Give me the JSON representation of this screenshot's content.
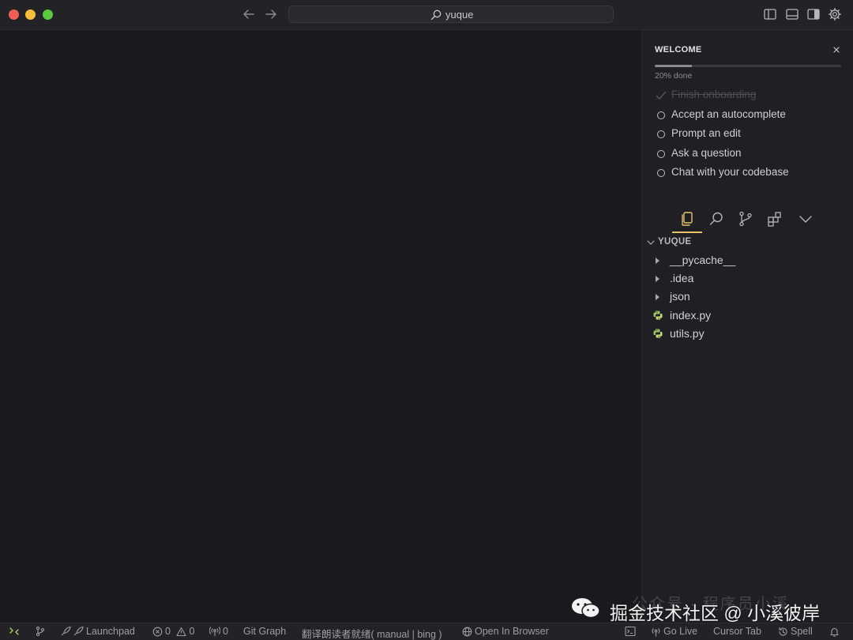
{
  "titlebar": {
    "search_text": "yuque"
  },
  "welcome": {
    "title": "WELCOME",
    "progress_percent": 20,
    "progress_label": "20% done",
    "items": [
      {
        "label": "Finish onboarding",
        "done": true
      },
      {
        "label": "Accept an autocomplete",
        "done": false
      },
      {
        "label": "Prompt an edit",
        "done": false
      },
      {
        "label": "Ask a question",
        "done": false
      },
      {
        "label": "Chat with your codebase",
        "done": false
      }
    ]
  },
  "explorer": {
    "root": "YUQUE",
    "items": [
      {
        "name": "__pycache__",
        "type": "folder"
      },
      {
        "name": ".idea",
        "type": "folder"
      },
      {
        "name": "json",
        "type": "folder"
      },
      {
        "name": "index.py",
        "type": "python"
      },
      {
        "name": "utils.py",
        "type": "python"
      }
    ]
  },
  "statusbar": {
    "launchpad": "Launchpad",
    "errors": "0",
    "warnings": "0",
    "ports": "0",
    "git_graph": "Git Graph",
    "translate": "翻译朗读者就绪( manual | bing )",
    "open_browser": "Open In Browser",
    "go_live": "Go Live",
    "cursor_tab": "Cursor Tab",
    "spell": "Spell"
  },
  "watermark": {
    "top_text": "公众号 · 程序员小溪",
    "text": "掘金技术社区 @ 小溪彼岸"
  },
  "colors": {
    "accent_underline": "#e7c36a",
    "python_icon": "#9bc36a"
  }
}
